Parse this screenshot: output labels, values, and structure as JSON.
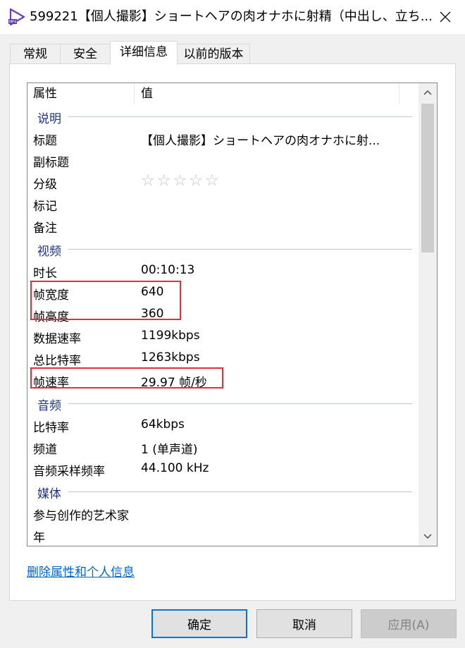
{
  "window": {
    "title": "599221【個人撮影】ショートヘアの肉オナホに射精（中出し、立ち...",
    "close_glyph": "✕"
  },
  "tabs": [
    {
      "label": "常规",
      "active": false
    },
    {
      "label": "安全",
      "active": false
    },
    {
      "label": "详细信息",
      "active": true
    },
    {
      "label": "以前的版本",
      "active": false
    }
  ],
  "list": {
    "headers": {
      "property": "属性",
      "value": "值"
    },
    "groups": {
      "description": "说明",
      "video": "视频",
      "audio": "音频",
      "media": "媒体"
    },
    "rows": {
      "title": {
        "name": "标题",
        "value": "【個人撮影】ショートヘアの肉オナホに射..."
      },
      "subtitle": {
        "name": "副标题",
        "value": ""
      },
      "rating": {
        "name": "分级",
        "value": "☆☆☆☆☆",
        "stars": 0,
        "max_stars": 5
      },
      "tags": {
        "name": "标记",
        "value": ""
      },
      "comments": {
        "name": "备注",
        "value": ""
      },
      "duration": {
        "name": "时长",
        "value": "00:10:13"
      },
      "frame_width": {
        "name": "帧宽度",
        "value": "640"
      },
      "frame_height": {
        "name": "帧高度",
        "value": "360"
      },
      "data_rate": {
        "name": "数据速率",
        "value": "1199kbps"
      },
      "total_bitrate": {
        "name": "总比特率",
        "value": "1263kbps"
      },
      "frame_rate": {
        "name": "帧速率",
        "value": "29.97 帧/秒"
      },
      "audio_bitrate": {
        "name": "比特率",
        "value": "64kbps"
      },
      "channels": {
        "name": "频道",
        "value": "1 (单声道)"
      },
      "sample_rate": {
        "name": "音频采样频率",
        "value": "44.100 kHz"
      },
      "contributing_artists": {
        "name": "参与创作的艺术家",
        "value": ""
      },
      "year": {
        "name": "年",
        "value": ""
      }
    }
  },
  "remove_link": "删除属性和个人信息",
  "buttons": {
    "ok": "确定",
    "cancel": "取消",
    "apply": "应用(A)"
  },
  "colors": {
    "highlight_box": "#e0303a",
    "link": "#0066cc",
    "group_header": "#1e3287",
    "default_button_border": "#0078d7"
  }
}
